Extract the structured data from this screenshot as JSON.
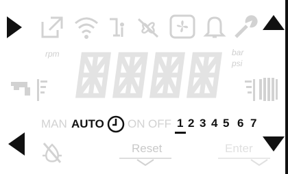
{
  "icons": [
    "external-link-icon",
    "wifi-icon",
    "temperature-probe-icon",
    "fan-off-icon",
    "fan-icon",
    "bell-icon",
    "wrench-icon"
  ],
  "display": {
    "left_unit": "rpm",
    "right_units": [
      "bar",
      "psi"
    ],
    "digits": "8888"
  },
  "modes": {
    "man": "MAN",
    "auto": "AUTO",
    "on": "ON",
    "off": "OFF"
  },
  "days": [
    "1",
    "2",
    "3",
    "4",
    "5",
    "6",
    "7"
  ],
  "selected_day": "1",
  "softkeys": {
    "reset": "Reset",
    "enter": "Enter"
  },
  "colors": {
    "active": "#111111",
    "inactive": "#d2d2d2"
  }
}
